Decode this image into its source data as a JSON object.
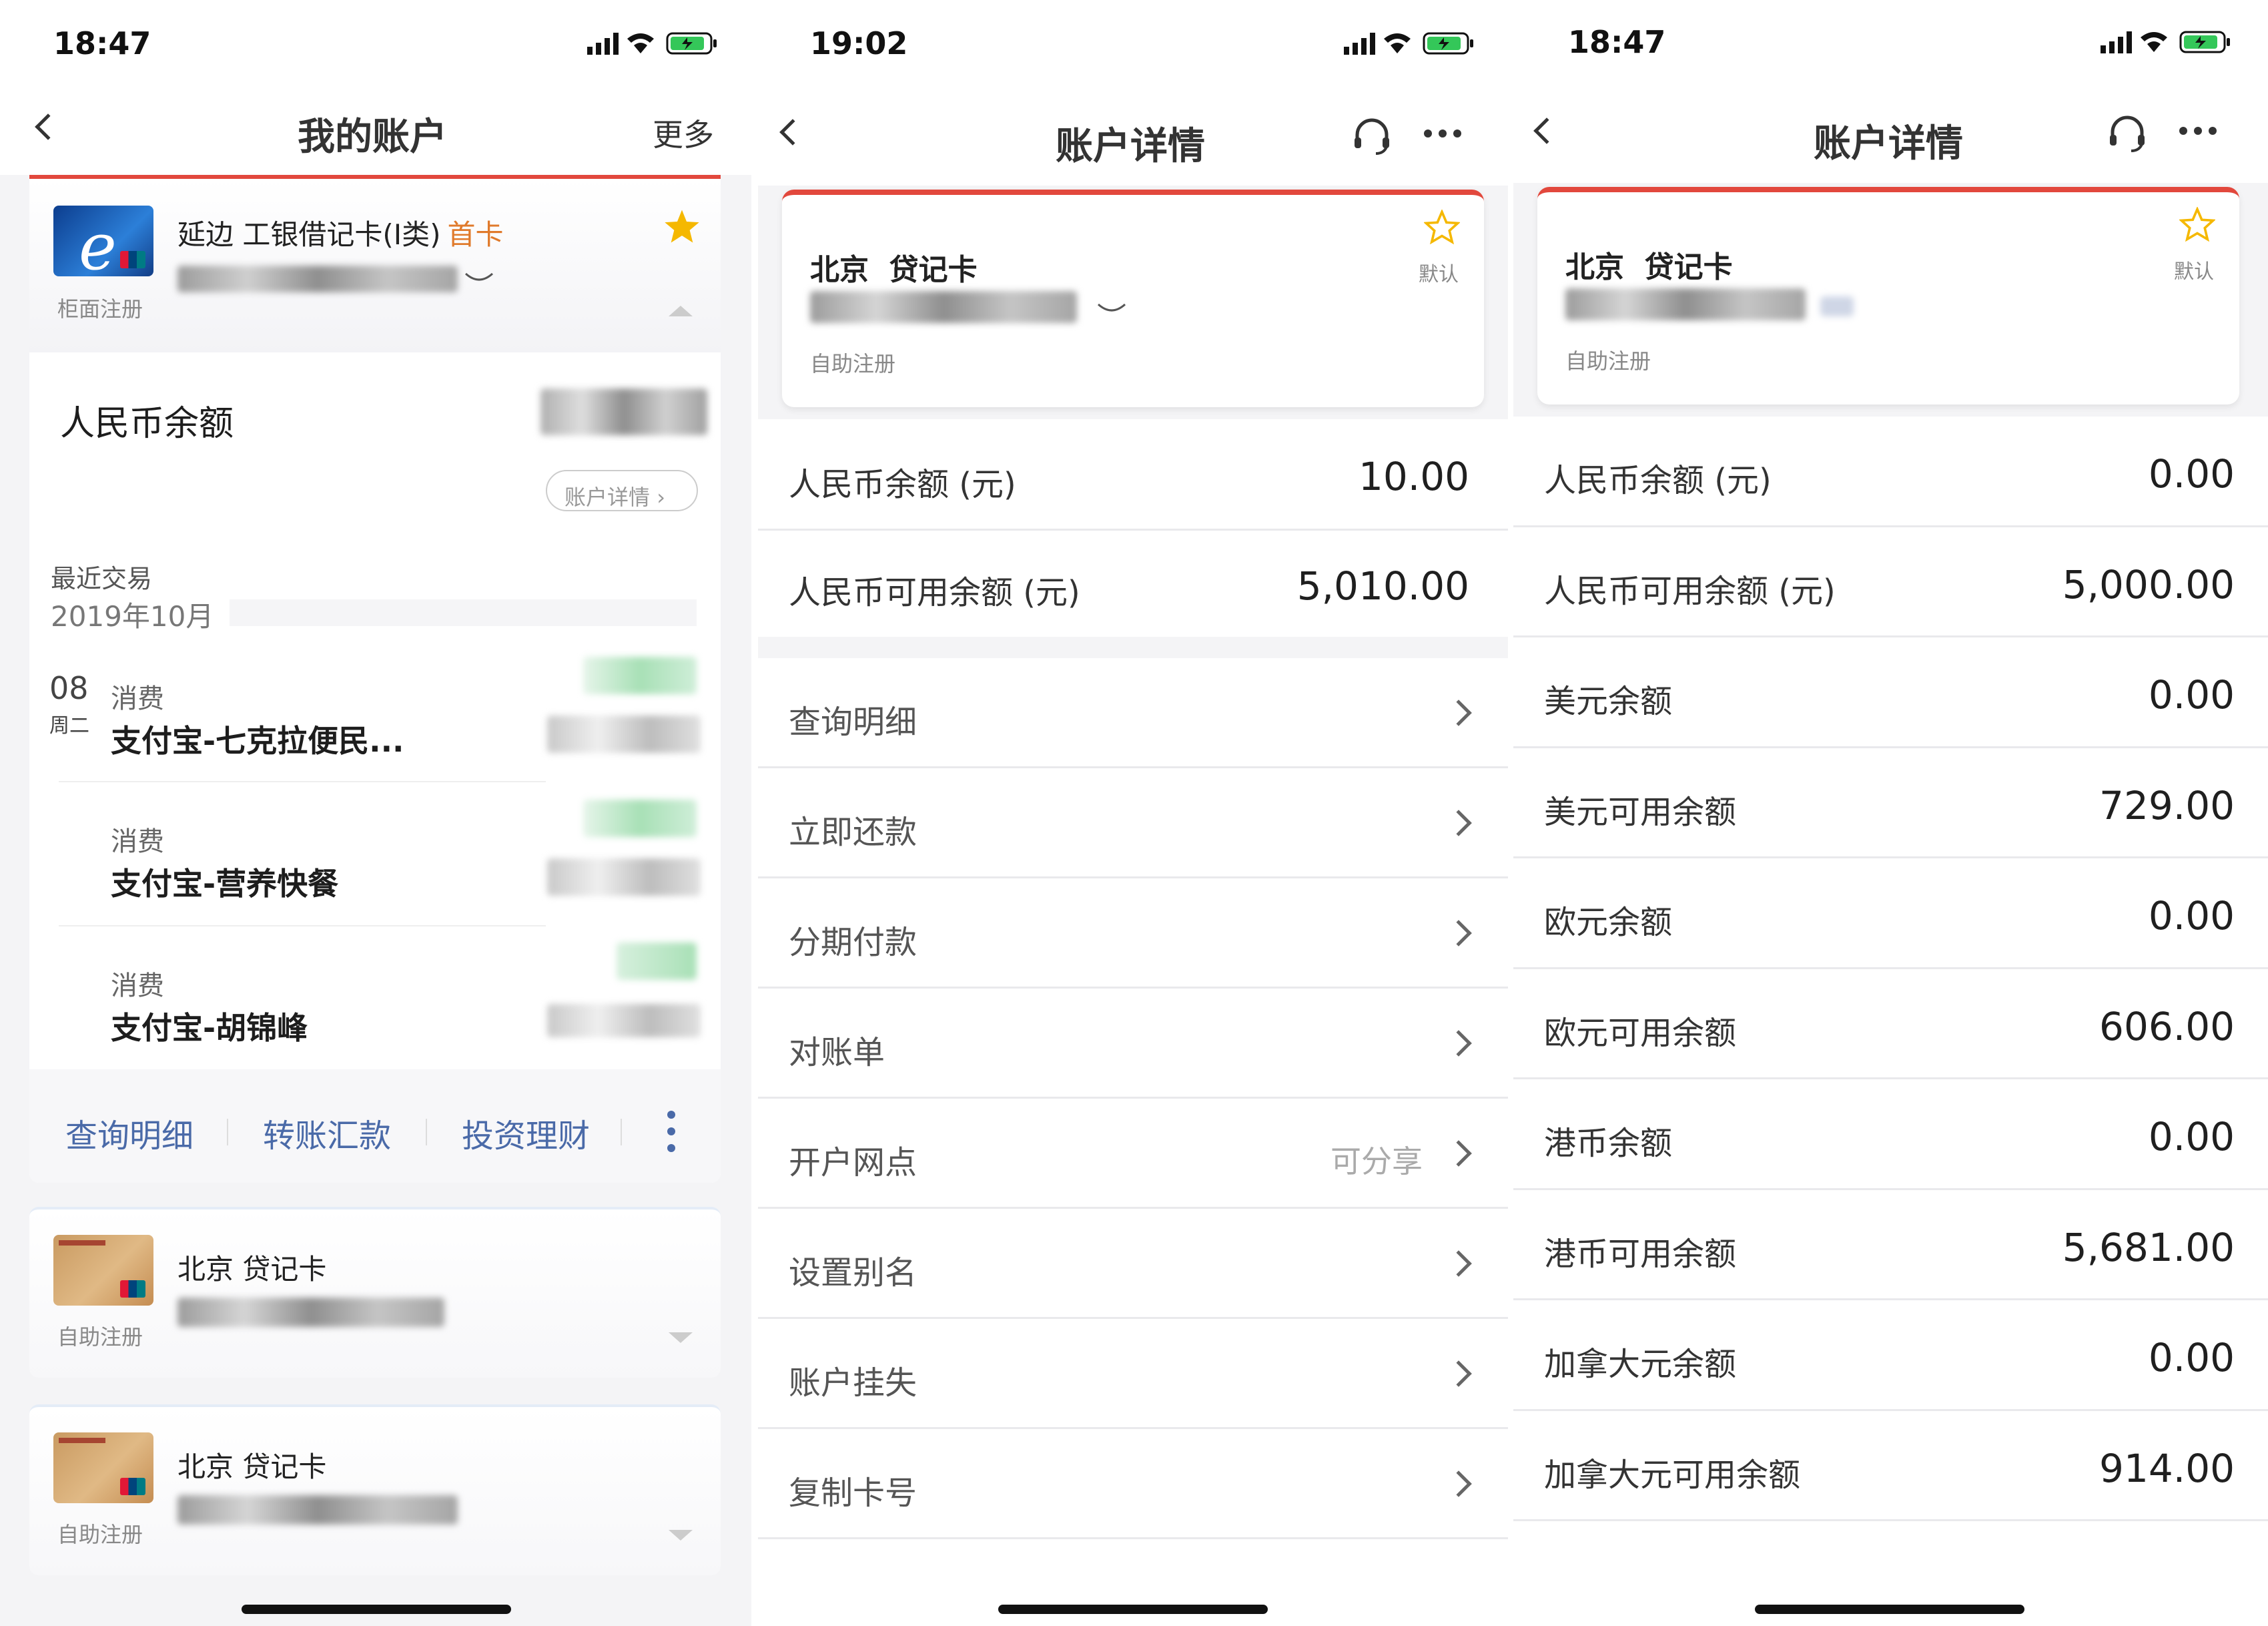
{
  "screen1": {
    "status_time": "18:47",
    "nav_title": "我的账户",
    "nav_more": "更多",
    "first_card": {
      "name": "延边 工银借记卡(Ⅰ类)",
      "tag": "首卡",
      "reg": "柜面注册"
    },
    "balance_label": "人民币余额",
    "detail_btn": "账户详情",
    "recent_label": "最近交易",
    "recent_month": "2019年10月",
    "transactions": [
      {
        "day": "08",
        "weekday": "周二",
        "type": "消费",
        "merchant": "支付宝-七克拉便民..."
      },
      {
        "type": "消费",
        "merchant": "支付宝-营养快餐"
      },
      {
        "type": "消费",
        "merchant": "支付宝-胡锦峰"
      }
    ],
    "actions": [
      "查询明细",
      "转账汇款",
      "投资理财"
    ],
    "other_cards": [
      {
        "name": "北京 贷记卡",
        "reg": "自助注册"
      },
      {
        "name": "北京 贷记卡",
        "reg": "自助注册"
      }
    ]
  },
  "screen2": {
    "status_time": "19:02",
    "nav_title": "账户详情",
    "card": {
      "name": "北京  贷记卡",
      "default": "默认",
      "reg": "自助注册"
    },
    "balances": [
      {
        "label": "人民币余额 (元)",
        "value": "10.00"
      },
      {
        "label": "人民币可用余额 (元)",
        "value": "5,010.00"
      }
    ],
    "menu": [
      {
        "label": "查询明细",
        "note": ""
      },
      {
        "label": "立即还款",
        "note": ""
      },
      {
        "label": "分期付款",
        "note": ""
      },
      {
        "label": "对账单",
        "note": ""
      },
      {
        "label": "开户网点",
        "note": "可分享"
      },
      {
        "label": "设置别名",
        "note": ""
      },
      {
        "label": "账户挂失",
        "note": ""
      },
      {
        "label": "复制卡号",
        "note": ""
      }
    ]
  },
  "screen3": {
    "status_time": "18:47",
    "nav_title": "账户详情",
    "card": {
      "name": "北京  贷记卡",
      "default": "默认",
      "reg": "自助注册"
    },
    "balances": [
      {
        "label": "人民币余额 (元)",
        "value": "0.00"
      },
      {
        "label": "人民币可用余额 (元)",
        "value": "5,000.00"
      },
      {
        "label": "美元余额",
        "value": "0.00"
      },
      {
        "label": "美元可用余额",
        "value": "729.00"
      },
      {
        "label": "欧元余额",
        "value": "0.00"
      },
      {
        "label": "欧元可用余额",
        "value": "606.00"
      },
      {
        "label": "港币余额",
        "value": "0.00"
      },
      {
        "label": "港币可用余额",
        "value": "5,681.00"
      },
      {
        "label": "加拿大元余额",
        "value": "0.00"
      },
      {
        "label": "加拿大元可用余额",
        "value": "914.00"
      }
    ]
  },
  "colors": {
    "accent_red": "#e2483d",
    "gold_star": "#f5b800",
    "link_blue": "#4a6aa8"
  }
}
